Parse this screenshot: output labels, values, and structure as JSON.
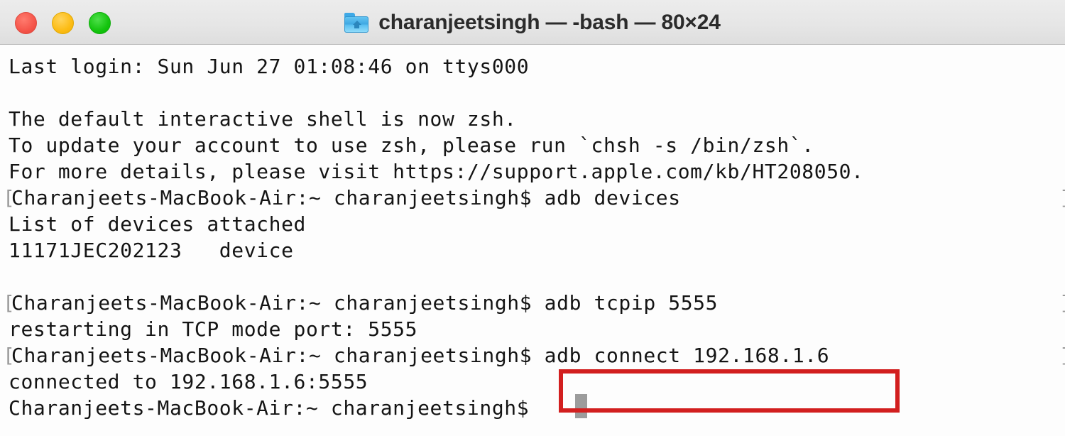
{
  "window": {
    "title": "charanjeetsingh — -bash — 80×24",
    "folder_icon": "home-folder-icon",
    "traffic_lights": [
      {
        "name": "close-button",
        "color": "#f5554a"
      },
      {
        "name": "minimize-button",
        "color": "#fcbc14"
      },
      {
        "name": "maximize-button",
        "color": "#14c40e"
      }
    ]
  },
  "terminal": {
    "background_color": "#fdfdfd",
    "text_color": "#141414",
    "prompt_bracket_color": "#9a9a9a",
    "cursor": {
      "name": "text-cursor",
      "color": "#9c9c9c"
    },
    "lines": [
      {
        "prompt": false,
        "text": "Last login: Sun Jun 27 01:08:46 on ttys000"
      },
      {
        "prompt": false,
        "text": ""
      },
      {
        "prompt": false,
        "text": "The default interactive shell is now zsh."
      },
      {
        "prompt": false,
        "text": "To update your account to use zsh, please run `chsh -s /bin/zsh`."
      },
      {
        "prompt": false,
        "text": "For more details, please visit https://support.apple.com/kb/HT208050."
      },
      {
        "prompt": true,
        "text": "Charanjeets-MacBook-Air:~ charanjeetsingh$ adb devices"
      },
      {
        "prompt": false,
        "text": "List of devices attached"
      },
      {
        "prompt": false,
        "text": "11171JEC202123\tdevice"
      },
      {
        "prompt": false,
        "text": ""
      },
      {
        "prompt": true,
        "text": "Charanjeets-MacBook-Air:~ charanjeetsingh$ adb tcpip 5555"
      },
      {
        "prompt": false,
        "text": "restarting in TCP mode port: 5555"
      },
      {
        "prompt": true,
        "text": "Charanjeets-MacBook-Air:~ charanjeetsingh$ adb connect 192.168.1.6"
      },
      {
        "prompt": false,
        "text": "connected to 192.168.1.6:5555"
      },
      {
        "prompt": false,
        "text": "Charanjeets-MacBook-Air:~ charanjeetsingh$ "
      }
    ],
    "prompt_bracket_open": "[",
    "prompt_bracket_close": "]"
  },
  "annotation": {
    "name": "red-highlight-box",
    "color": "#d21f1f",
    "highlighted_command": "adb connect 192.168.1.6"
  }
}
